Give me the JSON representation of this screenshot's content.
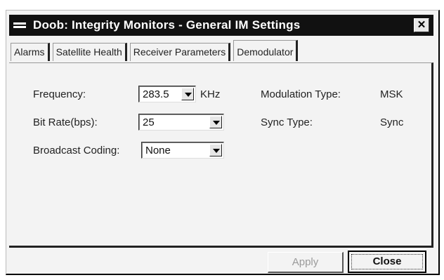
{
  "window": {
    "title": "Doob: Integrity Monitors - General IM Settings",
    "close_glyph": "✕"
  },
  "tabs": [
    {
      "label": "Alarms"
    },
    {
      "label": "Satellite Health"
    },
    {
      "label": "Receiver Parameters"
    },
    {
      "label": "Demodulator"
    }
  ],
  "active_tab": "Demodulator",
  "demodulator": {
    "frequency_label": "Frequency:",
    "frequency_value": "283.5",
    "frequency_unit": "KHz",
    "bitrate_label": "Bit Rate(bps):",
    "bitrate_value": "25",
    "coding_label": "Broadcast Coding:",
    "coding_value": "None",
    "modulation_label": "Modulation Type:",
    "modulation_value": "MSK",
    "sync_label": "Sync Type:",
    "sync_value": "Sync"
  },
  "buttons": {
    "apply": "Apply",
    "close": "Close"
  }
}
